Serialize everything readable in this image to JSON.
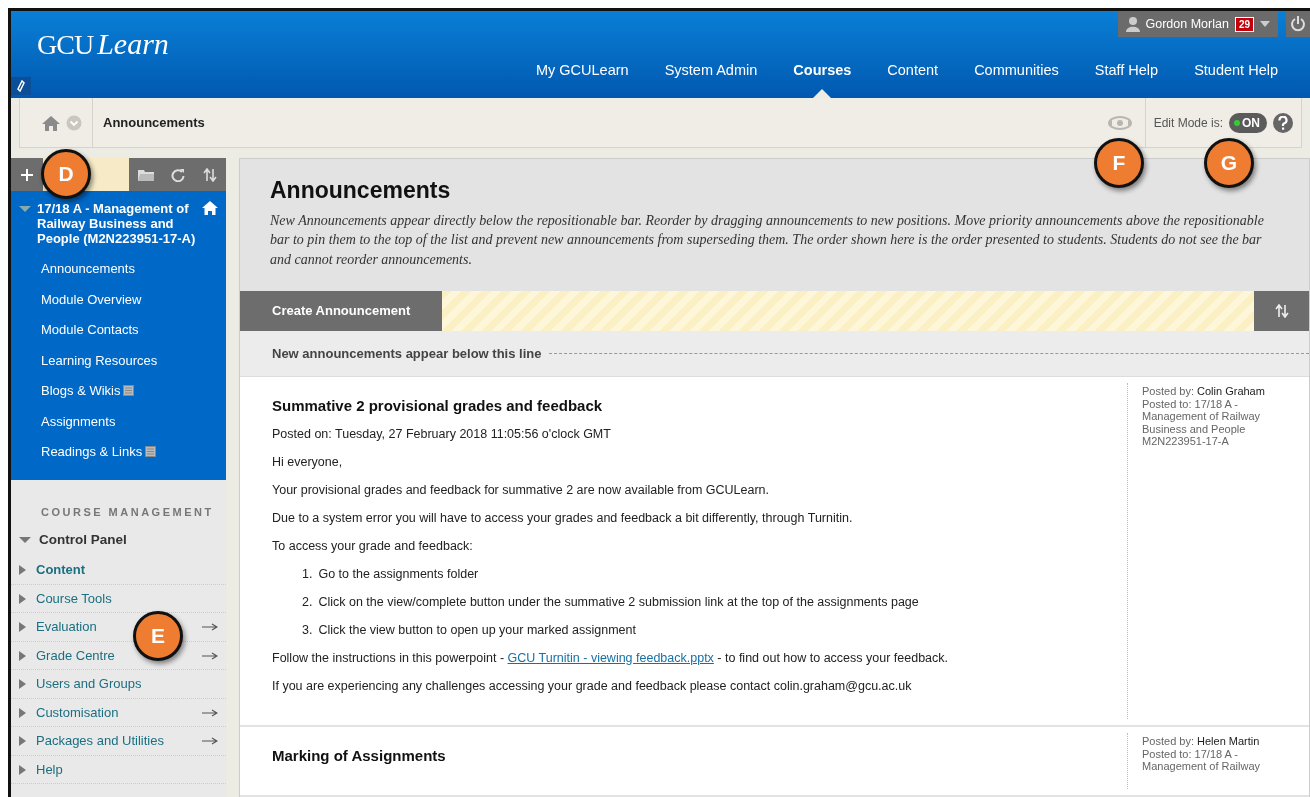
{
  "header": {
    "logo_main": "GCU",
    "logo_script": "Learn",
    "user": {
      "name": "Gordon Morlan",
      "badge": "29"
    },
    "tabs": [
      {
        "label": "My GCULearn",
        "selected": false
      },
      {
        "label": "System Admin",
        "selected": false
      },
      {
        "label": "Courses",
        "selected": true
      },
      {
        "label": "Content",
        "selected": false
      },
      {
        "label": "Communities",
        "selected": false
      },
      {
        "label": "Staff Help",
        "selected": false
      },
      {
        "label": "Student Help",
        "selected": false
      }
    ]
  },
  "breadcrumb": {
    "current": "Announcements"
  },
  "edit_mode": {
    "label": "Edit Mode is:",
    "on": true,
    "text": "ON"
  },
  "sidebar": {
    "course": {
      "title": "17/18 A - Management of Railway Business and People (M2N223951-17-A)",
      "expanded": true,
      "items": [
        {
          "label": "Announcements",
          "hidden_from_students": false
        },
        {
          "label": "Module Overview",
          "hidden_from_students": false
        },
        {
          "label": "Module Contacts",
          "hidden_from_students": false
        },
        {
          "label": "Learning Resources",
          "hidden_from_students": false
        },
        {
          "label": "Blogs & Wikis",
          "hidden_from_students": true
        },
        {
          "label": "Assignments",
          "hidden_from_students": false
        },
        {
          "label": "Readings & Links",
          "hidden_from_students": true
        }
      ]
    },
    "management": {
      "heading": "COURSE MANAGEMENT",
      "panel": {
        "label": "Control Panel",
        "expanded": true
      },
      "items": [
        {
          "label": "Content",
          "selected": true,
          "opens_page": false
        },
        {
          "label": "Course Tools",
          "selected": false,
          "opens_page": false
        },
        {
          "label": "Evaluation",
          "selected": false,
          "opens_page": true
        },
        {
          "label": "Grade Centre",
          "selected": false,
          "opens_page": true
        },
        {
          "label": "Users and Groups",
          "selected": false,
          "opens_page": false
        },
        {
          "label": "Customisation",
          "selected": false,
          "opens_page": true
        },
        {
          "label": "Packages and Utilities",
          "selected": false,
          "opens_page": true
        },
        {
          "label": "Help",
          "selected": false,
          "opens_page": false
        }
      ]
    }
  },
  "page": {
    "title": "Announcements",
    "description": "New Announcements appear directly below the repositionable bar. Reorder by dragging announcements to new positions. Move priority announcements above the repositionable bar to pin them to the top of the list and prevent new announcements from superseding them. The order shown here is the order presented to students. Students do not see the bar and cannot reorder announcements.",
    "create_button": "Create Announcement",
    "divider_text": "New announcements appear below this line",
    "announcements": [
      {
        "title": "Summative 2 provisional grades and feedback",
        "posted_on": "Posted on: Tuesday, 27 February 2018 11:05:56 o'clock GMT",
        "body": [
          {
            "kind": "text",
            "text": "Hi everyone,"
          },
          {
            "kind": "text",
            "text": "Your provisional grades and feedback for summative 2 are now available from GCULearn."
          },
          {
            "kind": "text",
            "text": "Due to a system error you will have to access your grades and feedback a bit differently, through Turnitin."
          },
          {
            "kind": "text",
            "text": "To access your grade and feedback:"
          },
          {
            "kind": "steps",
            "items": [
              {
                "number": "1.",
                "text": "Go to the assignments folder"
              },
              {
                "number": "2.",
                "text": "Click on the view/complete button under the summative 2 submission link at the top of the assignments page"
              },
              {
                "number": "3.",
                "text": "Click the view button to open up your marked assignment"
              }
            ]
          },
          {
            "kind": "link",
            "before": "Follow the instructions in this powerpoint - ",
            "link": "GCU Turnitin - viewing feedback.pptx",
            "after": " - to find out how to access your feedback."
          },
          {
            "kind": "text",
            "text": "If you are experiencing any challenges accessing your grade and feedback please contact colin.graham@gcu.ac.uk"
          }
        ],
        "meta": {
          "by_label": "Posted by:",
          "by": "Colin Graham",
          "to": "Posted to: 17/18 A - Management of Railway Business and People M2N223951-17-A"
        }
      },
      {
        "title": "Marking of Assignments",
        "meta": {
          "by_label": "Posted by:",
          "by": "Helen Martin",
          "to": "Posted to: 17/18 A - Management of Railway"
        }
      }
    ]
  },
  "callouts": [
    {
      "letter": "D"
    },
    {
      "letter": "E"
    },
    {
      "letter": "F"
    },
    {
      "letter": "G"
    }
  ]
}
